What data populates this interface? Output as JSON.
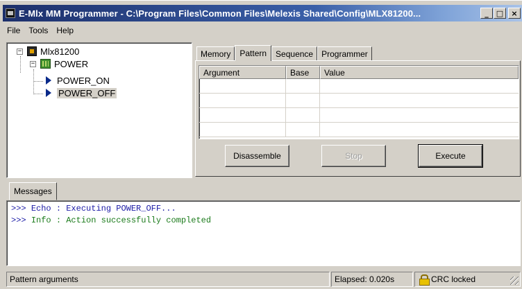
{
  "window": {
    "title": "E-Mlx MM Programmer - C:\\Program Files\\Common Files\\Melexis Shared\\Config\\MLX81200...",
    "controls": {
      "minimize": "_",
      "maximize": "□",
      "close": "×"
    }
  },
  "menu": {
    "items": [
      "File",
      "Tools",
      "Help"
    ]
  },
  "tree": {
    "root": {
      "label": "Mlx81200",
      "expander": "−",
      "icon": "chip-icon"
    },
    "group": {
      "label": "POWER",
      "expander": "−",
      "icon": "board-icon"
    },
    "actions": [
      {
        "label": "POWER_ON",
        "icon": "play-icon",
        "selected": false
      },
      {
        "label": "POWER_OFF",
        "icon": "play-icon",
        "selected": true
      }
    ]
  },
  "tabs": {
    "items": [
      "Memory",
      "Pattern",
      "Sequence",
      "Programmer"
    ],
    "active": "Pattern"
  },
  "pattern_table": {
    "columns": [
      "Argument",
      "Base",
      "Value"
    ],
    "rows": [
      [
        "",
        "",
        ""
      ],
      [
        "",
        "",
        ""
      ],
      [
        "",
        "",
        ""
      ],
      [
        "",
        "",
        ""
      ]
    ]
  },
  "buttons": {
    "disassemble": "Disassemble",
    "stop": "Stop",
    "execute": "Execute"
  },
  "messages": {
    "tab_label": "Messages",
    "lines": [
      {
        "prefix": ">>>",
        "kind": "Echo",
        "sep": ":",
        "text": "Executing POWER_OFF...",
        "color": "#1a1aa6"
      },
      {
        "prefix": ">>>",
        "kind": "Info",
        "sep": ":",
        "text": "Action successfully completed",
        "color": "#1a7a1a"
      }
    ]
  },
  "status": {
    "hint": "Pattern arguments",
    "elapsed": "Elapsed: 0.020s",
    "crc": "CRC locked"
  }
}
